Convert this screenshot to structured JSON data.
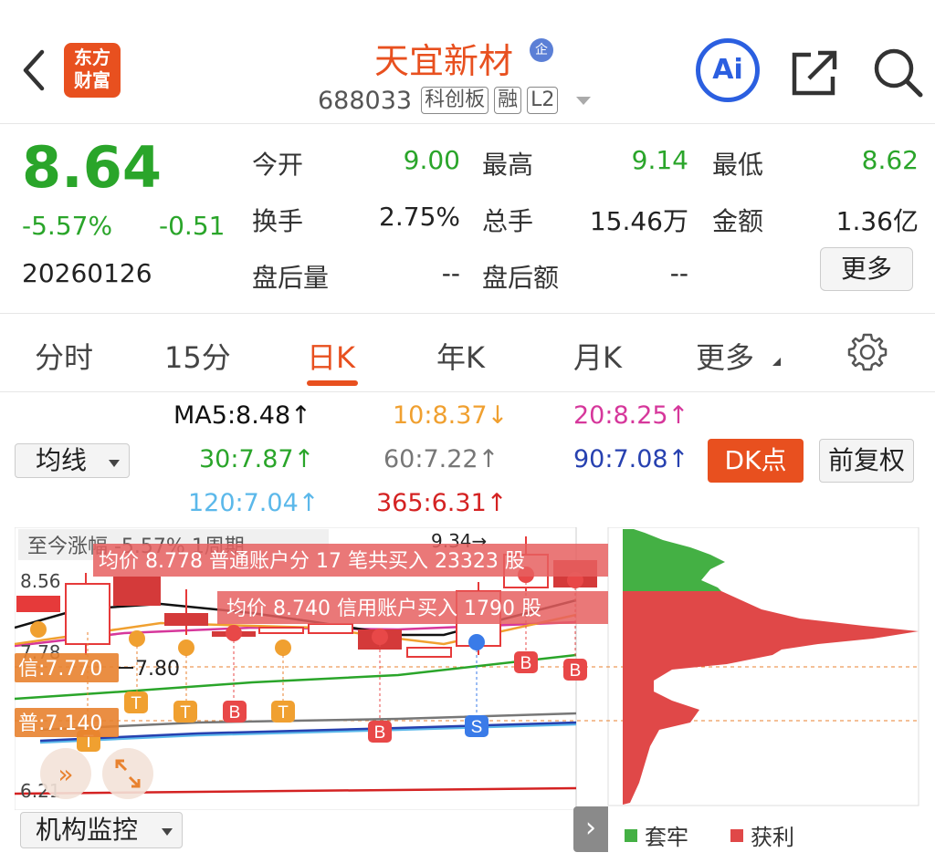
{
  "header": {
    "logo_line1": "东方",
    "logo_line2": "财富",
    "title": "天宜新材",
    "title_badge": "企",
    "code": "688033",
    "tags": [
      "科创板",
      "融",
      "L2"
    ],
    "ai_label": "Ai"
  },
  "quote": {
    "price": "8.64",
    "pct": "-5.57%",
    "change": "-0.51",
    "date": "20260126",
    "fields": [
      {
        "label": "今开",
        "value": "9.00",
        "color": "green"
      },
      {
        "label": "最高",
        "value": "9.14",
        "color": "green"
      },
      {
        "label": "最低",
        "value": "8.62",
        "color": "green"
      },
      {
        "label": "换手",
        "value": "2.75%",
        "color": "black"
      },
      {
        "label": "总手",
        "value": "15.46万",
        "color": "black"
      },
      {
        "label": "金额",
        "value": "1.36亿",
        "color": "black"
      },
      {
        "label": "盘后量",
        "value": "--",
        "color": "black"
      },
      {
        "label": "盘后额",
        "value": "--",
        "color": "black"
      }
    ],
    "more_label": "更多"
  },
  "tabs": {
    "items": [
      "分时",
      "15分",
      "日K",
      "年K",
      "月K",
      "更多"
    ],
    "active": "日K"
  },
  "ma": {
    "ma5": "MA5:8.48↑",
    "ma10": "10:8.37↓",
    "ma20": "20:8.25↑",
    "ma30": "30:7.87↑",
    "ma60": "60:7.22↑",
    "ma90": "90:7.08↑",
    "ma120": "120:7.04↑",
    "ma365": "365:6.31↑",
    "select_label": "均线",
    "dk_label": "DK点",
    "fq_label": "前复权"
  },
  "chart": {
    "top_label": "至今涨幅 -5.57% 1周期",
    "high_mark": "9.34→",
    "price_labels": [
      "8.56",
      "7.78",
      "6.21"
    ],
    "avg_line_1": "均价 8.778 普通账户分 17 笔共买入 23323 股",
    "avg_line_2": "均价 8.740 信用账户买入 1790 股",
    "xin_tag": "信:7.770",
    "pu_tag": "普:7.140",
    "mark_780": "7.80",
    "letters": {
      "t": "T",
      "b": "B",
      "s": "S"
    },
    "colors": {
      "up": "#e63a3a",
      "down": "#2aa52a",
      "ma5": "#111111",
      "ma10": "#f0a030",
      "ma20": "#d6379b",
      "ma30": "#2aa52a",
      "ma60": "#777777",
      "ma90": "#2741b0",
      "ma120": "#5bb8ea",
      "ma365": "#d42222"
    }
  },
  "chart_data": {
    "type": "bar",
    "title": "",
    "chip_distribution": {
      "legend": [
        {
          "name": "套牢",
          "color": "#44b044"
        },
        {
          "name": "获利",
          "color": "#e04848"
        }
      ]
    }
  },
  "bottom": {
    "select_label": "机构监控",
    "legend_trapped": "套牢",
    "legend_profit": "获利"
  }
}
